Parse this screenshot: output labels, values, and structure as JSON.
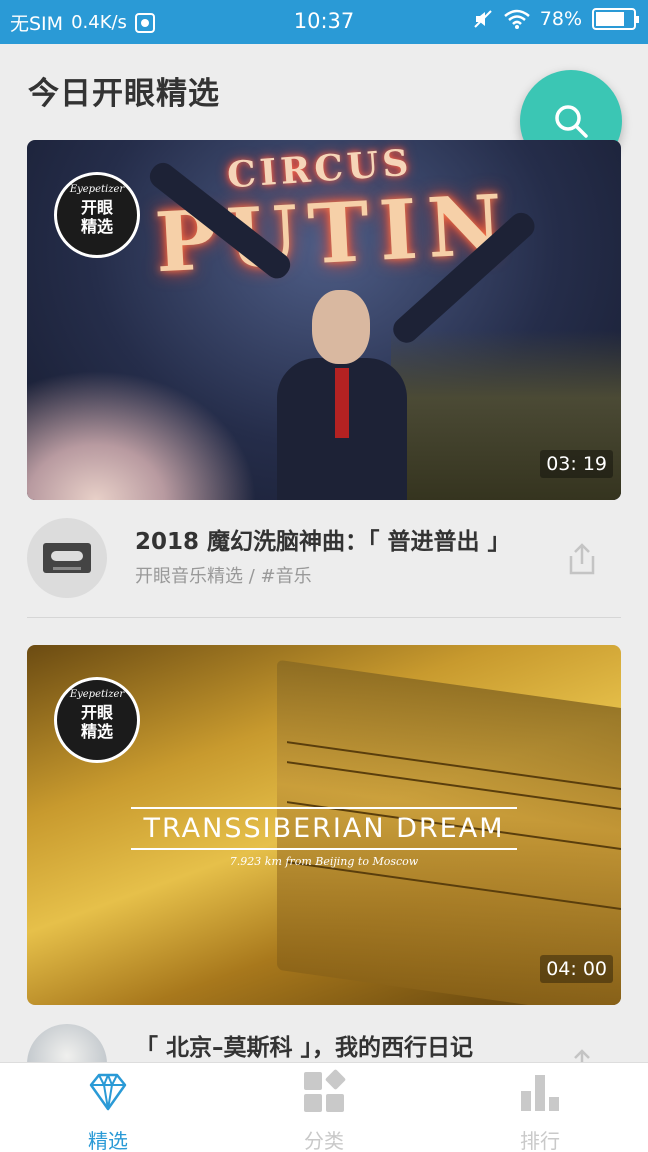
{
  "status_bar": {
    "carrier": "无SIM",
    "speed": "0.4K/s",
    "time": "10:37",
    "battery": "78%",
    "battery_level": 0.78
  },
  "header": {
    "title": "今日开眼精选",
    "search_icon": "search-icon"
  },
  "badge": {
    "brand": "Eyepetizer",
    "line1": "开眼",
    "line2": "精选"
  },
  "videos": [
    {
      "thumbnail_text_small": "CIRCUS",
      "thumbnail_text_big": "PUTIN",
      "duration": "03: 19",
      "title": "2018 魔幻洗脑神曲：「 普进普出 」",
      "subtitle": "开眼音乐精选 / #音乐",
      "avatar_icon": "cassette-icon"
    },
    {
      "thumbnail_title": "TRANSSIBERIAN DREAM",
      "thumbnail_subtitle": "7.923 km from Beijing to Moscow",
      "duration": "04: 00",
      "title": "「 北京–莫斯科 」，我的西行日记"
    }
  ],
  "bottom_nav": {
    "items": [
      {
        "label": "精选",
        "icon": "diamond-icon",
        "active": true
      },
      {
        "label": "分类",
        "icon": "grid-icon",
        "active": false
      },
      {
        "label": "排行",
        "icon": "bar-chart-icon",
        "active": false
      }
    ]
  },
  "colors": {
    "status_bar": "#2a9ad6",
    "accent": "#3bc6b4",
    "nav_active": "#2a9ad6",
    "nav_inactive": "#c9c9c9"
  }
}
